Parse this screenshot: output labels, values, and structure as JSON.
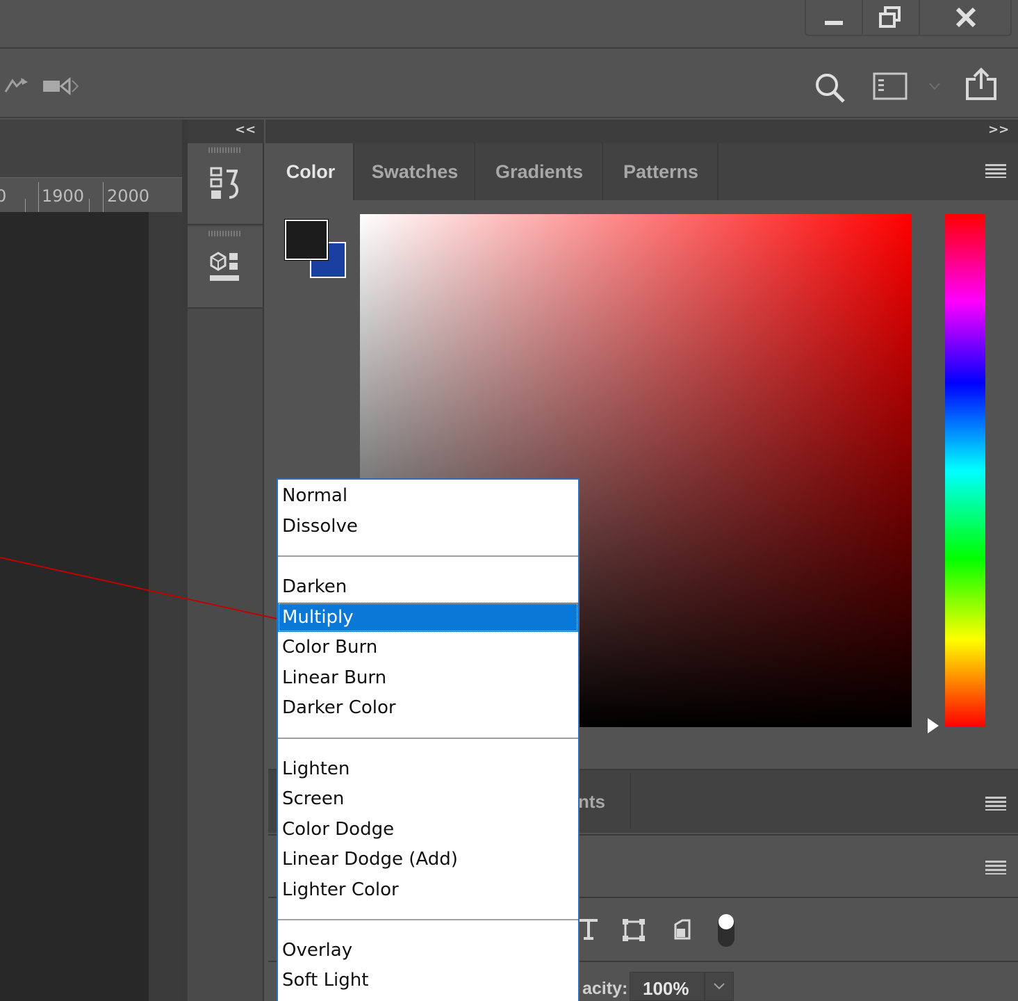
{
  "ruler": {
    "labels": [
      "0",
      "1900",
      "2000"
    ]
  },
  "panel": {
    "collapse_left": "<<",
    "expand_right": ">>",
    "tabs": [
      {
        "label": "Color",
        "active": true
      },
      {
        "label": "Swatches",
        "active": false
      },
      {
        "label": "Gradients",
        "active": false
      },
      {
        "label": "Patterns",
        "active": false
      }
    ],
    "foreground_color": "#1c1c1c",
    "background_color": "#1b3fa0",
    "picker_hue": "#ff0000",
    "lower_tab_partial": "nts"
  },
  "layers": {
    "opacity_label": "acity:",
    "opacity_value": "100%"
  },
  "blend_menu": {
    "selected": "Multiply",
    "groups": [
      [
        "Normal",
        "Dissolve"
      ],
      [
        "Darken",
        "Multiply",
        "Color Burn",
        "Linear Burn",
        "Darker Color"
      ],
      [
        "Lighten",
        "Screen",
        "Color Dodge",
        "Linear Dodge (Add)",
        "Lighter Color"
      ],
      [
        "Overlay",
        "Soft Light"
      ]
    ],
    "items": {
      "normal": "Normal",
      "dissolve": "Dissolve",
      "darken": "Darken",
      "multiply": "Multiply",
      "color_burn": "Color Burn",
      "linear_burn": "Linear Burn",
      "darker_color": "Darker Color",
      "lighten": "Lighten",
      "screen": "Screen",
      "color_dodge": "Color Dodge",
      "linear_dodge": "Linear Dodge (Add)",
      "lighter_color": "Lighter Color",
      "overlay": "Overlay",
      "soft_light": "Soft Light"
    }
  },
  "annotation_color": "#c00000"
}
